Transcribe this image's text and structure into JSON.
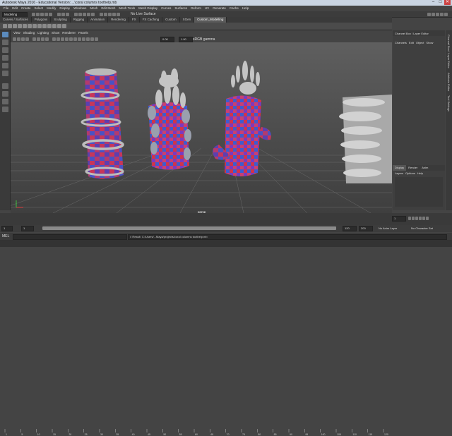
{
  "window": {
    "title": "Autodesk Maya 2016 - Educational Version: ...\\coral columns toothelp.mb",
    "controls": [
      "–",
      "□",
      "✕"
    ]
  },
  "menubar": [
    "File",
    "Edit",
    "Create",
    "Select",
    "Modify",
    "Display",
    "Windows",
    "Mesh",
    "Edit Mesh",
    "Mesh Tools",
    "Mesh Display",
    "Curves",
    "Surfaces",
    "Deform",
    "UV",
    "Generate",
    "Cache",
    "Help"
  ],
  "status": {
    "mode": "Modeling",
    "live_surface": "No Live Surface"
  },
  "shelf": {
    "tabs": [
      "Curves / Surfaces",
      "Polygons",
      "Sculpting",
      "Rigging",
      "Animation",
      "Rendering",
      "FX",
      "FX Caching",
      "Custom",
      "XGen",
      "Custom_Modelling"
    ],
    "active": "Custom_Modelling"
  },
  "viewport": {
    "menu": [
      "View",
      "Shading",
      "Lighting",
      "Show",
      "Renderer",
      "Panels"
    ],
    "field1": "0.00",
    "field2": "1.00",
    "gamma": "sRGB gamma",
    "camera_label": "persp"
  },
  "right_panel": {
    "header": "Channel Box / Layer Editor",
    "menu": [
      "Channels",
      "Edit",
      "Object",
      "Show"
    ],
    "layer_tabs": [
      "Display",
      "Render",
      "Anim"
    ],
    "layer_menu": [
      "Layers",
      "Options",
      "Help"
    ],
    "side_tabs": [
      "Channel Box / Layer Editor",
      "Attribute Editor",
      "Tool Settings"
    ]
  },
  "time_slider": {
    "ticks": [
      "1",
      "5",
      "10",
      "15",
      "20",
      "25",
      "30",
      "35",
      "40",
      "45",
      "50",
      "55",
      "60",
      "65",
      "70",
      "75",
      "80",
      "85",
      "90",
      "95",
      "100",
      "105",
      "110",
      "115",
      "120"
    ],
    "current_frame": "1"
  },
  "range_slider": {
    "start": "1",
    "playback_start": "1",
    "playback_end": "120",
    "end": "120",
    "anim_end": "200",
    "anim_layer": "No Anim Layer",
    "char_set": "No Character Set"
  },
  "command_line": {
    "lang": "MEL",
    "result": "// Result: C:/Users/...Maya/projects/coral columns toothelp.mb"
  },
  "colors": {
    "viewport_bg": "#555555",
    "accent": "#5b8bbd"
  }
}
